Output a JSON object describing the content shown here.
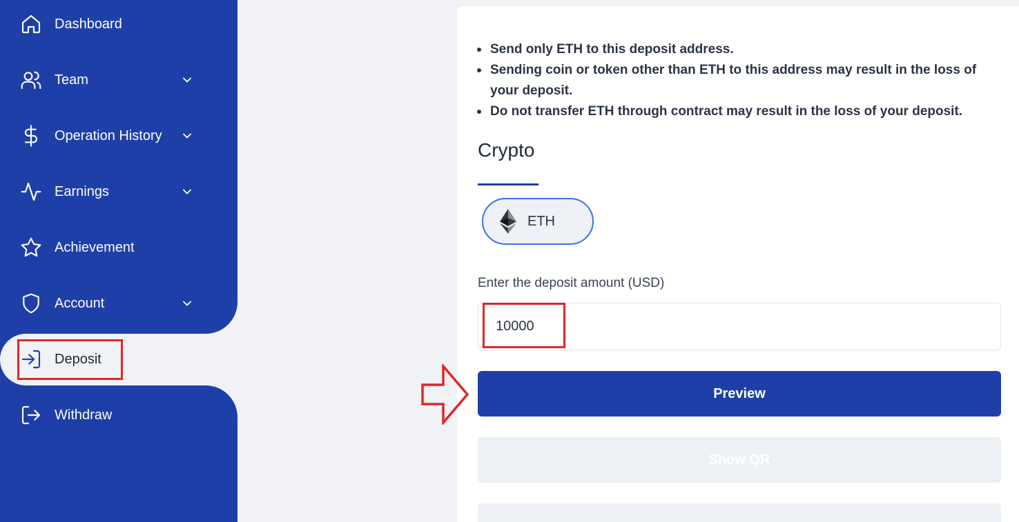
{
  "sidebar": {
    "items": [
      {
        "label": "Dashboard",
        "icon": "home-icon",
        "has_children": false
      },
      {
        "label": "Team",
        "icon": "users-icon",
        "has_children": true
      },
      {
        "label": "Operation History",
        "icon": "dollar-icon",
        "has_children": true
      },
      {
        "label": "Earnings",
        "icon": "activity-icon",
        "has_children": true
      },
      {
        "label": "Achievement",
        "icon": "star-icon",
        "has_children": false
      },
      {
        "label": "Account",
        "icon": "shield-icon",
        "has_children": true
      },
      {
        "label": "Deposit",
        "icon": "log-in-icon",
        "has_children": false,
        "active": true
      },
      {
        "label": "Withdraw",
        "icon": "log-out-icon",
        "has_children": false
      }
    ]
  },
  "deposit": {
    "notes": [
      "Send only ETH to this deposit address.",
      "Sending coin or token other than ETH to this address may result in the loss of your deposit.",
      "Do not transfer ETH through contract may result in the loss of your deposit."
    ],
    "section_title": "Crypto",
    "coin": {
      "label": "ETH",
      "icon": "ethereum-icon"
    },
    "amount_label": "Enter the deposit amount (USD)",
    "amount_value": "10000",
    "preview_button": "Preview",
    "show_qr_button": "Show QR"
  },
  "colors": {
    "primary": "#1f3fa8",
    "annotation": "#e0262a",
    "background": "#f0f2f5"
  }
}
